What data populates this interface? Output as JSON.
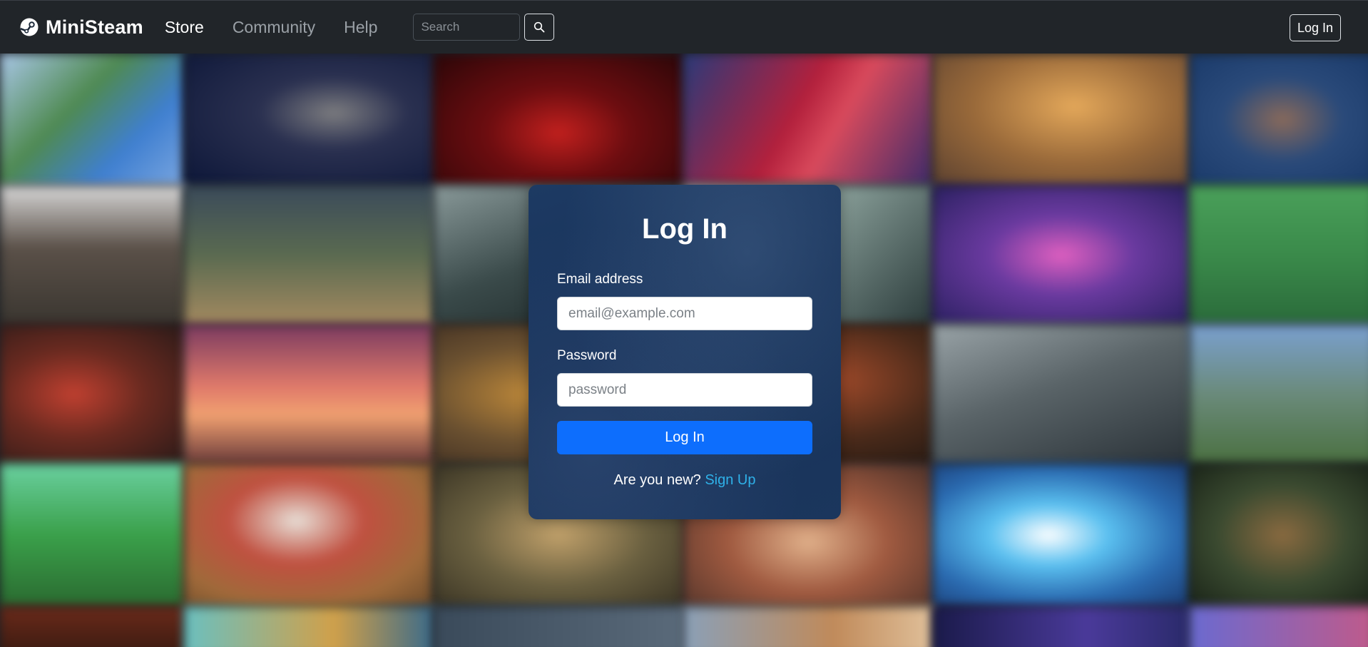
{
  "navbar": {
    "brand": "MiniSteam",
    "links": [
      {
        "label": "Store",
        "active": true
      },
      {
        "label": "Community",
        "active": false
      },
      {
        "label": "Help",
        "active": false
      }
    ],
    "search": {
      "placeholder": "Search",
      "value": ""
    },
    "login_label": "Log In"
  },
  "login_form": {
    "title": "Log In",
    "email_label": "Email address",
    "email_placeholder": "email@example.com",
    "password_label": "Password",
    "password_placeholder": "password",
    "submit_label": "Log In",
    "new_prompt": "Are you new?",
    "signup_label": "Sign Up"
  },
  "colors": {
    "navbar_bg": "#212529",
    "primary_button": "#0d6efd",
    "link": "#2fb1e8",
    "card_bg": "#163158"
  }
}
